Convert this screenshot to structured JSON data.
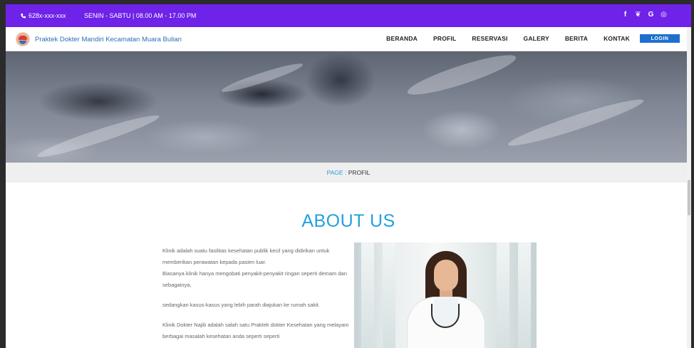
{
  "topbar": {
    "phone": "628x-xxx-xxx",
    "hours": "SENIN - SABTU | 08.00 AM - 17.00 PM",
    "social": [
      {
        "icon": "facebook-icon",
        "glyph": "f"
      },
      {
        "icon": "twitter-icon",
        "glyph": "❦"
      },
      {
        "icon": "google-icon",
        "glyph": "G"
      },
      {
        "icon": "instagram-icon",
        "glyph": "◎"
      }
    ],
    "color": "#6f22e8"
  },
  "navbar": {
    "brand": "Praktek Dokter Mandiri Kecamatan Muara Bulian",
    "menu": [
      "BERANDA",
      "PROFIL",
      "RESERVASI",
      "GALERY",
      "BERITA",
      "KONTAK"
    ],
    "login": "LOGIN"
  },
  "breadcrumb": {
    "page_label": "PAGE",
    "separator": " : ",
    "current": "PROFIL"
  },
  "about": {
    "title": "ABOUT US",
    "paragraph1_a": "Klinik adalah suatu fasilitas kesehatan publik kecil yang didirikan untuk memberikan perawatan kepada pasien luar.",
    "paragraph1_b": "Biasanya klinik hanya mengobati penyakit-penyakit ringan seperti demam dan sebagainya,",
    "paragraph2": "sedangkan kasus-kasus yang lebih parah diajukan ke rumah sakit.",
    "paragraph3": "Klinik Dokter Najib adalah salah satu Praktek dokter Kesehatan yang melayani berbagai masalah kesehatan  anda seperti seperti",
    "accent_color": "#23a0dc"
  }
}
